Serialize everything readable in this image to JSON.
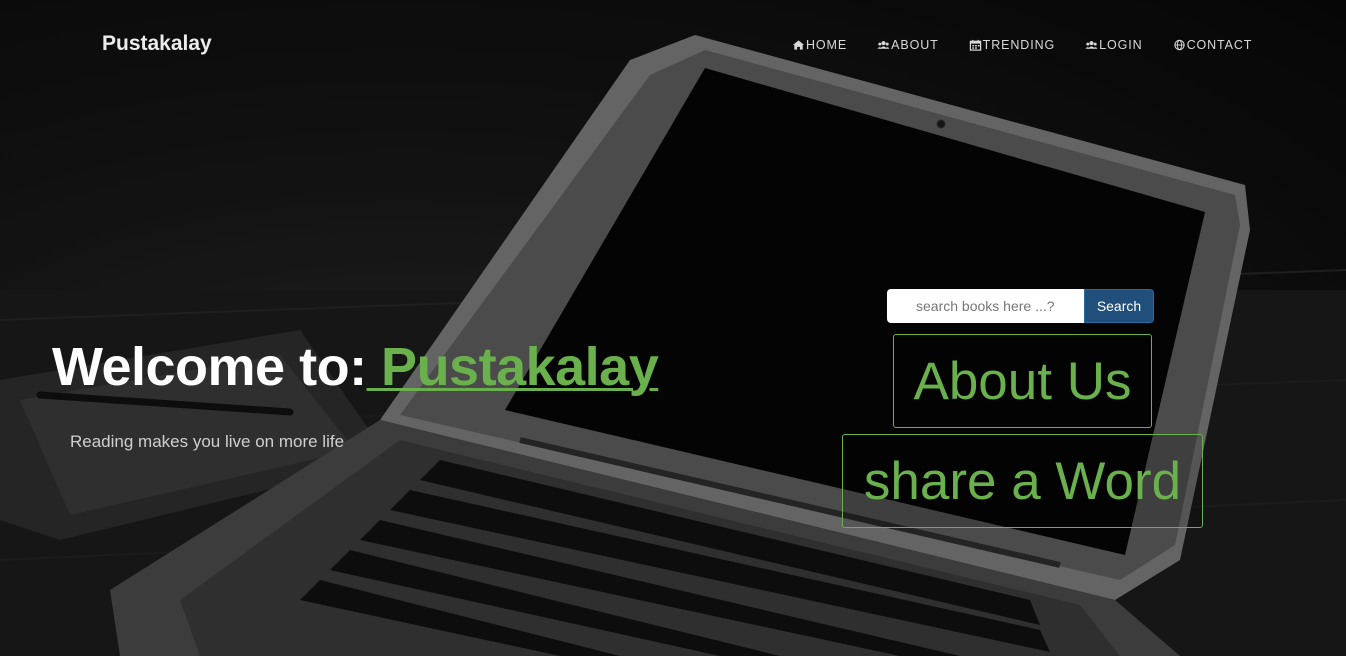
{
  "brand": {
    "name": "Pustakalay"
  },
  "nav": {
    "items": [
      {
        "label": "HOME",
        "icon": "home-icon"
      },
      {
        "label": "ABOUT",
        "icon": "users-icon"
      },
      {
        "label": "TRENDING",
        "icon": "calendar-icon"
      },
      {
        "label": "LOGIN",
        "icon": "users-icon"
      },
      {
        "label": "CONTACT",
        "icon": "globe-icon"
      }
    ]
  },
  "hero": {
    "welcome_prefix": "Welcome to:",
    "welcome_brand": " Pustakalay",
    "tagline": "Reading makes you live on more life"
  },
  "search": {
    "placeholder": "search books here ...?",
    "value": "",
    "button_label": "Search"
  },
  "actions": {
    "about_label": "About Us",
    "share_label": "share a Word"
  },
  "colors": {
    "accent": "#6ab04c",
    "search_button": "#1f4f7a",
    "nav_text": "#d8d8d8"
  }
}
